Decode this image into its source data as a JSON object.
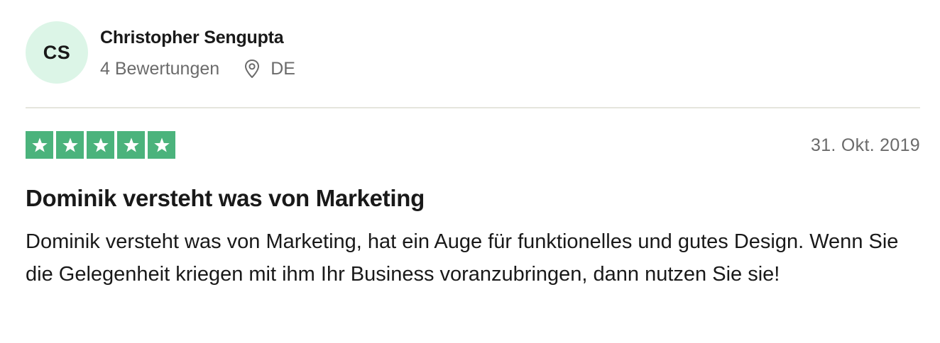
{
  "reviewer": {
    "initials": "CS",
    "name": "Christopher Sengupta",
    "review_count": "4 Bewertungen",
    "country": "DE",
    "avatar_color": "#dcf5e7"
  },
  "review": {
    "rating": 5,
    "max_rating": 5,
    "star_color": "#4bb37c",
    "date": "31. Okt. 2019",
    "title": "Dominik versteht was von Marketing",
    "body": "Dominik versteht was von Marketing, hat ein Auge für funktionelles und gutes Design. Wenn Sie die Gelegenheit kriegen mit ihm Ihr Business voranzubringen, dann nutzen Sie sie!"
  },
  "icons": {
    "location": "map-pin-icon",
    "star": "star-icon"
  }
}
